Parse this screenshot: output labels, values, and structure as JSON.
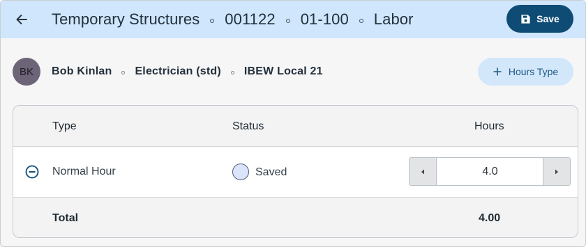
{
  "header": {
    "breadcrumbs": [
      "Temporary Structures",
      "001122",
      "01-100",
      "Labor"
    ],
    "save_label": "Save"
  },
  "worker": {
    "initials": "BK",
    "name": "Bob Kinlan",
    "role": "Electrician (std)",
    "union": "IBEW Local 21"
  },
  "hours_type_button": "Hours Type",
  "table": {
    "columns": {
      "type": "Type",
      "status": "Status",
      "hours": "Hours"
    },
    "rows": [
      {
        "type": "Normal Hour",
        "status": "Saved",
        "hours": "4.0"
      }
    ],
    "total_label": "Total",
    "total_value": "4.00"
  },
  "colors": {
    "header_bg": "#cfe6fd",
    "primary": "#0f4c75",
    "secondary_button_bg": "#d3e7fb"
  }
}
